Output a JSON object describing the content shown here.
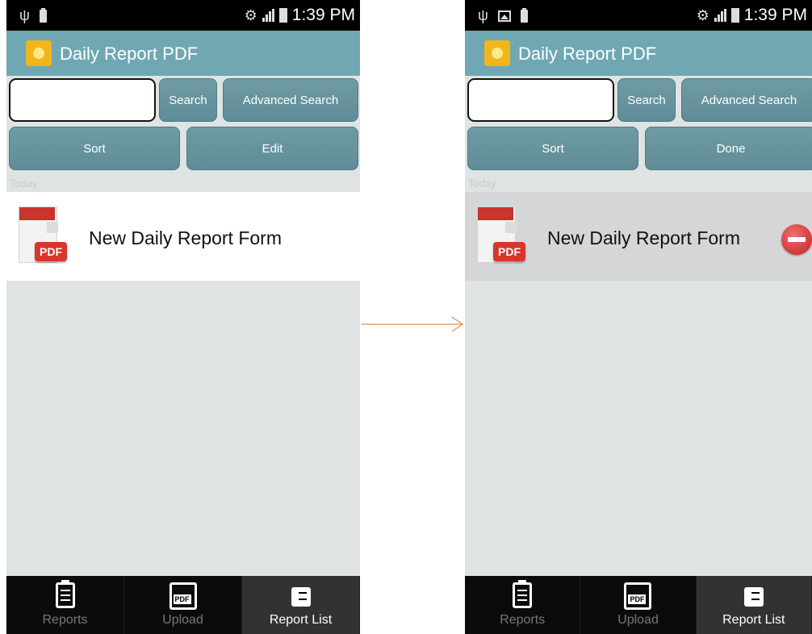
{
  "colors": {
    "action_bar": "#6fa8b3",
    "button": "#5f8c96",
    "delete": "#c51f1f",
    "arrow": "#e98b55"
  },
  "screens": [
    {
      "status": {
        "time": "1:39 PM"
      },
      "app_title": "Daily Report PDF",
      "search": {
        "value": "",
        "button_label": "Search",
        "advanced_label": "Advanced Search"
      },
      "sort_label": "Sort",
      "edit_label": "Edit",
      "section": "Today",
      "rows": [
        {
          "title": "New Daily Report Form",
          "badge": "PDF"
        }
      ],
      "tabs": [
        {
          "label": "Reports",
          "icon": "clipboard-icon",
          "active": false
        },
        {
          "label": "Upload",
          "icon": "pdf-document-icon",
          "active": false
        },
        {
          "label": "Report List",
          "icon": "checklist-icon",
          "active": true
        }
      ]
    },
    {
      "status": {
        "time": "1:39 PM"
      },
      "app_title": "Daily Report PDF",
      "search": {
        "value": "",
        "button_label": "Search",
        "advanced_label": "Advanced Search"
      },
      "sort_label": "Sort",
      "edit_label": "Done",
      "section": "Today",
      "rows": [
        {
          "title": "New Daily Report Form",
          "badge": "PDF",
          "delete_icon": "delete-icon"
        }
      ],
      "tabs": [
        {
          "label": "Reports",
          "icon": "clipboard-icon",
          "active": false
        },
        {
          "label": "Upload",
          "icon": "pdf-document-icon",
          "active": false
        },
        {
          "label": "Report List",
          "icon": "checklist-icon",
          "active": true
        }
      ]
    }
  ]
}
